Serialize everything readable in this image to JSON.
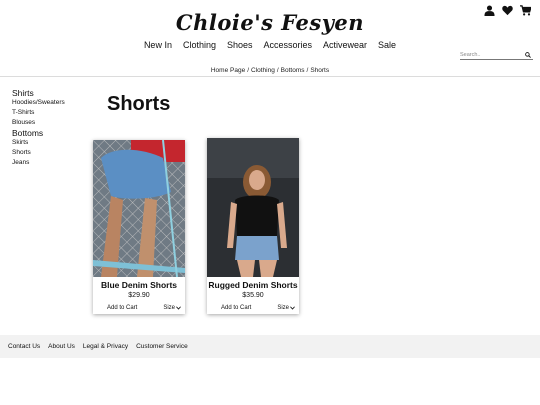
{
  "brand": {
    "logo_text": "Chloie's Fesyen"
  },
  "header_icons": [
    "user-icon",
    "heart-icon",
    "cart-icon"
  ],
  "nav": {
    "items": [
      "New In",
      "Clothing",
      "Shoes",
      "Accessories",
      "Activewear",
      "Sale"
    ]
  },
  "search": {
    "placeholder": "Search..",
    "value": ""
  },
  "breadcrumb": [
    "Home Page",
    "Clothing",
    "Bottoms",
    "Shorts"
  ],
  "sidebar": {
    "groups": [
      {
        "label": "Shirts",
        "items": [
          "Hoodies/Sweaters",
          "T-Shirts",
          "Blouses"
        ]
      },
      {
        "label": "Bottoms",
        "items": [
          "Skirts",
          "Shorts",
          "Jeans"
        ]
      }
    ]
  },
  "page": {
    "title": "Shorts"
  },
  "products": [
    {
      "name": "Blue Denim Shorts",
      "price": "$29.90",
      "add_to_cart": "Add to Cart",
      "size_label": "Size"
    },
    {
      "name": "Rugged Denim Shorts",
      "price": "$35.90",
      "add_to_cart": "Add to Cart",
      "size_label": "Size"
    }
  ],
  "footer": {
    "links": [
      "Contact Us",
      "About Us",
      "Legal & Privacy",
      "Customer Service"
    ]
  }
}
